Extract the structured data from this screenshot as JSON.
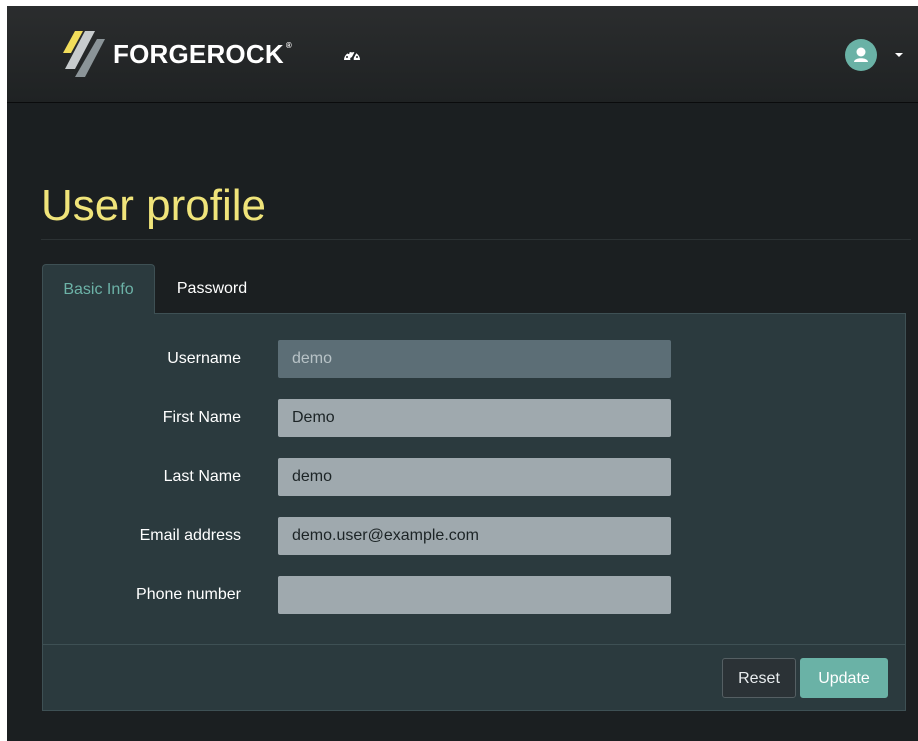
{
  "header": {
    "brand_name": "FORGEROCK",
    "brand_trademark": "®",
    "dashboard_icon": "dashboard-gauge-icon",
    "user_icon": "user-avatar-icon",
    "menu_icon": "caret-down-icon"
  },
  "page": {
    "title": "User profile"
  },
  "tabs": [
    {
      "label": "Basic Info",
      "active": true
    },
    {
      "label": "Password",
      "active": false
    }
  ],
  "form": {
    "fields": [
      {
        "label": "Username",
        "value": "demo",
        "readonly": true
      },
      {
        "label": "First Name",
        "value": "Demo",
        "readonly": false
      },
      {
        "label": "Last Name",
        "value": "demo",
        "readonly": false
      },
      {
        "label": "Email address",
        "value": "demo.user@example.com",
        "readonly": false
      },
      {
        "label": "Phone number",
        "value": "",
        "readonly": false
      }
    ]
  },
  "buttons": {
    "reset_label": "Reset",
    "update_label": "Update"
  },
  "colors": {
    "accent": "#6ab2a6",
    "title": "#f0e47a",
    "panel_bg": "#2b3a3e",
    "page_bg": "#1b1f21"
  }
}
